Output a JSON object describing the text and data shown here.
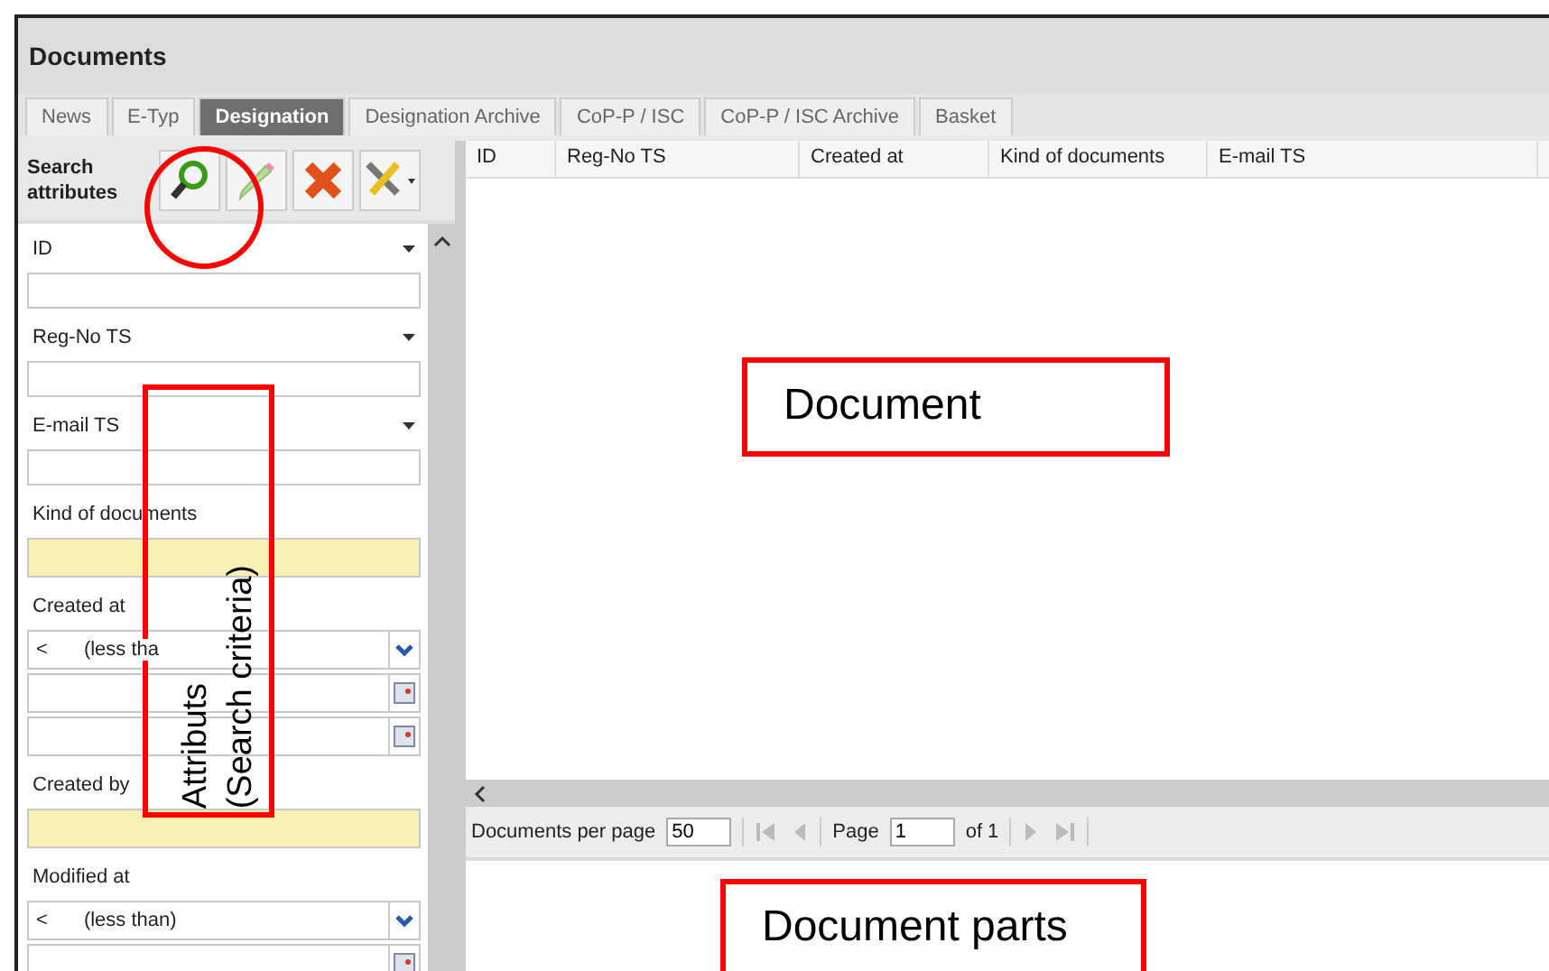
{
  "window": {
    "title": "Documents"
  },
  "tabs": [
    {
      "label": "News",
      "selected": false
    },
    {
      "label": "E-Typ",
      "selected": false
    },
    {
      "label": "Designation",
      "selected": true
    },
    {
      "label": "Designation Archive",
      "selected": false
    },
    {
      "label": "CoP-P / ISC",
      "selected": false
    },
    {
      "label": "CoP-P / ISC Archive",
      "selected": false
    },
    {
      "label": "Basket",
      "selected": false
    }
  ],
  "search_panel": {
    "title": "Search attributes",
    "filters": [
      {
        "label": "ID",
        "kind": "text"
      },
      {
        "label": "Reg-No TS",
        "kind": "text"
      },
      {
        "label": "E-mail TS",
        "kind": "text"
      },
      {
        "label": "Kind of documents",
        "kind": "lookup"
      },
      {
        "label": "Created at",
        "kind": "range",
        "operator": "<",
        "operator_text": "(less tha"
      },
      {
        "label": "Created by",
        "kind": "lookup"
      },
      {
        "label": "Modified at",
        "kind": "range",
        "operator": "<",
        "operator_text": "(less than)"
      }
    ]
  },
  "grid": {
    "columns": [
      "ID",
      "Reg-No TS",
      "Created at",
      "Kind of documents",
      "E-mail TS"
    ]
  },
  "pager": {
    "per_page_label": "Documents per page",
    "per_page": "50",
    "page_label": "Page",
    "page": "1",
    "of_text": "of 1"
  },
  "annotations": [
    {
      "kind": "circle"
    },
    {
      "kind": "vertical",
      "lines": [
        "Attributs",
        "(Search criteria)"
      ]
    },
    {
      "kind": "box",
      "text": "Document"
    },
    {
      "kind": "box",
      "text": "Document parts"
    }
  ]
}
